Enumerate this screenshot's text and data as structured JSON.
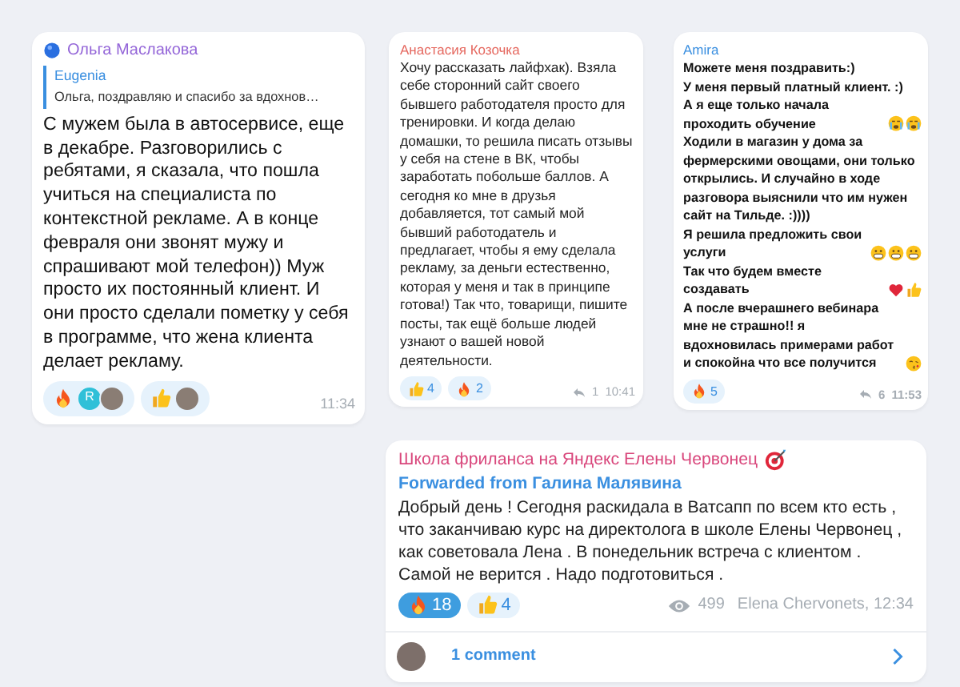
{
  "messages": [
    {
      "author": "Ольга Маслакова",
      "color": "#9466d8",
      "badge": {
        "kind": "circle"
      },
      "reply": {
        "author": "Eugenia",
        "text": "Ольга, поздравляю и спасибо за вдохнов…"
      },
      "text": "С мужем была в автосервисе, еще в декабре. Разговорились с ребятами, я сказала, что пошла учиться на специалиста по контекстной рекламе. А в конце февраля они звонят мужу и спрашивают мой телефон)) Муж просто их постоянный клиент. И они просто сделали пометку у себя в программе, что жена клиента  делает рекламу.",
      "reactions": [
        {
          "kind": "fire",
          "selected": false,
          "avatars": [
            {
              "kind": "letter",
              "text": "R",
              "color": "#2fc0d8"
            },
            {
              "kind": "photo"
            }
          ]
        },
        {
          "kind": "thumbs",
          "selected": false,
          "avatars": [
            {
              "kind": "photo"
            }
          ]
        }
      ],
      "time": "11:34"
    },
    {
      "author": "Анастасия Козочка",
      "color": "#e5685f",
      "text": "Хочу рассказать лайфхак). Взяла себе сторонний сайт своего бывшего работодателя просто для тренировки. И когда делаю домашки, то решила писать отзывы у себя на стене в ВК, чтобы заработать побольше баллов. А сегодня ко мне в друзья добавляется, тот самый мой бывший работодатель и предлагает, чтобы я ему сделала рекламу, за деньги естественно, которая у меня и так в принципе готова!) Так что, товарищи, пишите посты, так ещё больше людей узнают о вашей новой деятельности.",
      "reactions": [
        {
          "kind": "thumbs",
          "count": "4",
          "selected": false
        },
        {
          "kind": "fire",
          "count": "2",
          "selected": false
        }
      ],
      "replies": "1",
      "time": "10:41"
    },
    {
      "author": "Amira",
      "color": "#3a8fe0",
      "lines": [
        [
          {
            "kind": "text",
            "text": "Можете меня поздравить:)"
          }
        ],
        [
          {
            "kind": "text",
            "text": "У меня первый платный клиент. :)"
          }
        ],
        [
          {
            "kind": "text",
            "text": "А я еще только начала проходить обучение"
          },
          {
            "kind": "crying"
          },
          {
            "kind": "crying"
          }
        ],
        [
          {
            "kind": "text",
            "text": "Ходили в магазин у дома за фермерскими овощами, они только открылись. И случайно в ходе разговора выяснили что им нужен сайт на Тильде. :))))"
          }
        ],
        [
          {
            "kind": "text",
            "text": "Я решила предложить свои услуги"
          },
          {
            "kind": "grin"
          },
          {
            "kind": "grin"
          },
          {
            "kind": "grin"
          }
        ],
        [
          {
            "kind": "text",
            "text": "Так что будем вместе создавать"
          },
          {
            "kind": "heart"
          },
          {
            "kind": "thumbs"
          }
        ],
        [
          {
            "kind": "text",
            "text": "А после вчерашнего вебинара мне не страшно!! я вдохновилась примерами работ и спокойна что все получится"
          },
          {
            "kind": "kiss"
          }
        ]
      ],
      "reactions": [
        {
          "kind": "fire",
          "count": "5",
          "selected": false
        }
      ],
      "replies": "6",
      "time": "11:53"
    },
    {
      "author": "Школа фриланса на Яндекс Елены Червонец",
      "color": "#d9477c",
      "badge": {
        "kind": "dart"
      },
      "forwarded": "Forwarded from Галина Малявина",
      "text": "Добрый день ! Сегодня раскидала в Ватсапп по всем кто есть , что заканчиваю курс на директолога в школе Елены Червонец , как советовала Лена . В понедельник встреча с клиентом . Самой не верится . Надо подготовиться .",
      "reactions": [
        {
          "kind": "fire",
          "count": "18",
          "selected": true
        },
        {
          "kind": "thumbs",
          "count": "4",
          "selected": false
        }
      ],
      "views": "499",
      "time": "Elena Chervonets, 12:34",
      "comments": "1 comment"
    }
  ]
}
